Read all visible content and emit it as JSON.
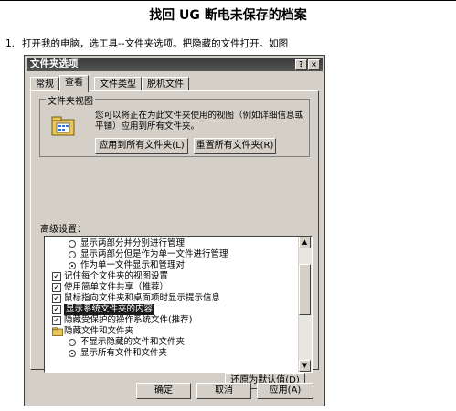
{
  "document": {
    "title": "找回 UG 断电未保存的档案",
    "step_number": "1.",
    "step_text": "打开我的电脑，选工具--文件夹选项。把隐藏的文件打开。如图"
  },
  "dialog": {
    "title": "文件夹选项",
    "help_glyph": "?",
    "close_glyph": "×",
    "tabs": [
      {
        "label": "常规"
      },
      {
        "label": "查看",
        "active": true
      },
      {
        "label": "文件类型"
      },
      {
        "label": "脱机文件"
      }
    ],
    "folder_views": {
      "legend": "文件夹视图",
      "description": "您可以将正在为此文件夹使用的视图（例如详细信息或平铺）应用到所有文件夹。",
      "apply_all_label": "应用到所有文件夹(L)",
      "reset_all_label": "重置所有文件夹(R)"
    },
    "advanced_label": "高级设置：",
    "advanced_items": [
      {
        "kind": "radio",
        "indent": 2,
        "checked": false,
        "text": "显示两部分并分别进行管理"
      },
      {
        "kind": "radio",
        "indent": 2,
        "checked": false,
        "text": "显示两部分但是作为单一文件进行管理"
      },
      {
        "kind": "radio",
        "indent": 2,
        "checked": true,
        "text": "作为单一文件显示和管理对"
      },
      {
        "kind": "check",
        "indent": 1,
        "checked": true,
        "text": "记住每个文件夹的视图设置"
      },
      {
        "kind": "check",
        "indent": 1,
        "checked": true,
        "text": "使用简单文件共享（推荐）"
      },
      {
        "kind": "check",
        "indent": 1,
        "checked": true,
        "text": "鼠标指向文件夹和桌面项时显示提示信息"
      },
      {
        "kind": "check",
        "indent": 1,
        "checked": true,
        "text": "显示系统文件夹的内容",
        "selected": true
      },
      {
        "kind": "check",
        "indent": 1,
        "checked": true,
        "text": "隐藏受保护的操作系统文件(推荐)"
      },
      {
        "kind": "folder",
        "indent": 1,
        "checked": false,
        "text": "隐藏文件和文件夹"
      },
      {
        "kind": "radio",
        "indent": 2,
        "checked": false,
        "text": "不显示隐藏的文件和文件夹"
      },
      {
        "kind": "radio",
        "indent": 2,
        "checked": true,
        "text": "显示所有文件和文件夹"
      }
    ],
    "scroll_up_glyph": "▲",
    "scroll_down_glyph": "▼",
    "restore_defaults_label": "还原为默认值(D)",
    "ok_label": "确定",
    "cancel_label": "取消",
    "apply_label": "应用(A)"
  }
}
